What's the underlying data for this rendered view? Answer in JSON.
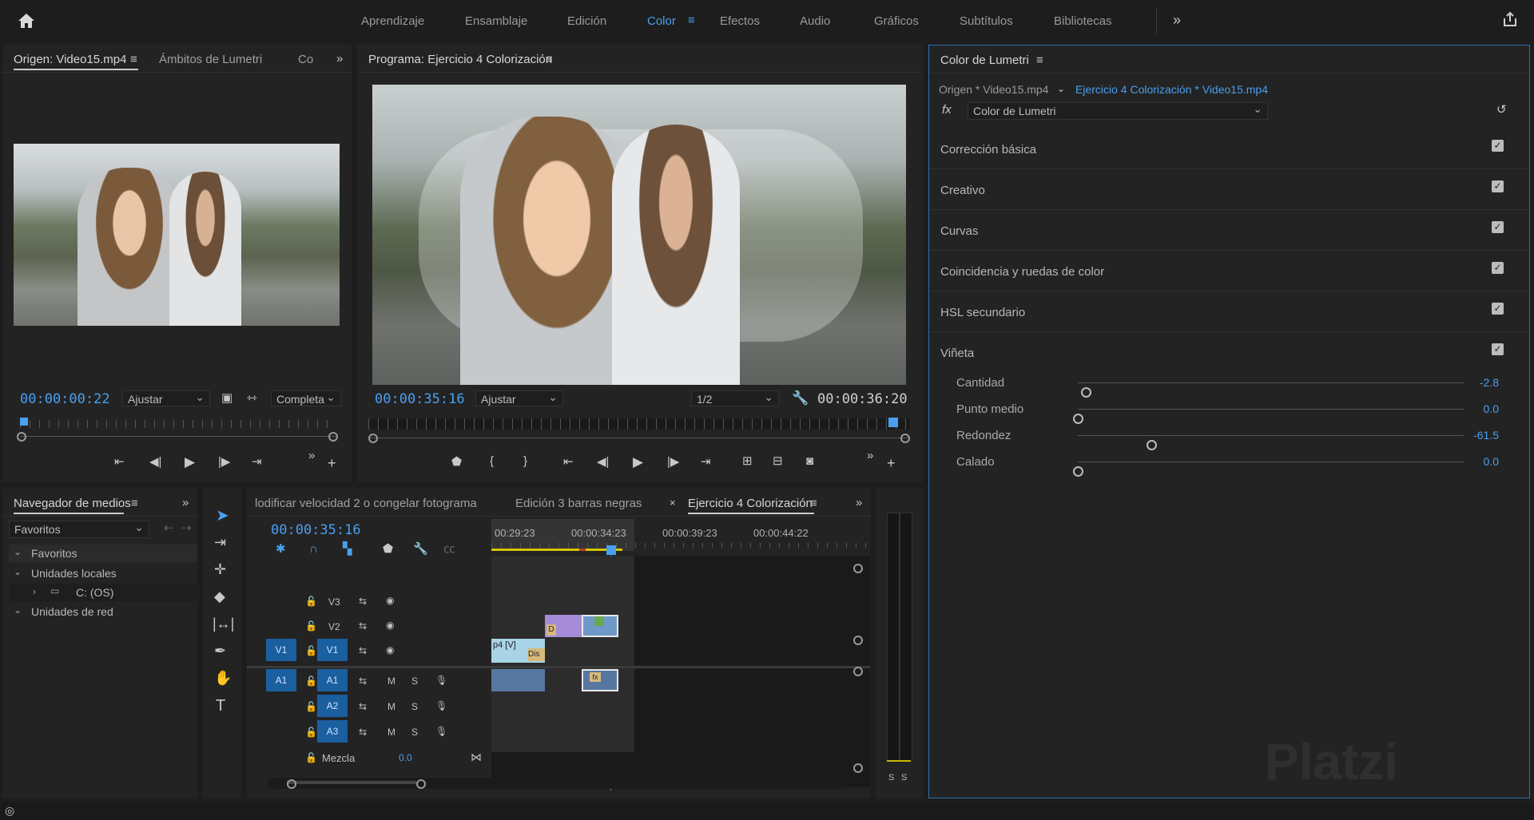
{
  "menubar": {
    "home_icon": "home-icon",
    "items": [
      "Aprendizaje",
      "Ensamblaje",
      "Edición",
      "Color",
      "Efectos",
      "Audio",
      "Gráficos",
      "Subtítulos",
      "Bibliotecas"
    ],
    "active": "Color",
    "overflow": "»"
  },
  "source_monitor": {
    "tabs": [
      "Origen: Video15.mp4",
      "Ámbitos de Lumetri",
      "Co"
    ],
    "timecode": "00:00:00:22",
    "fit": "Ajustar",
    "quality": "Completa"
  },
  "program_monitor": {
    "title": "Programa: Ejercicio 4 Colorización",
    "timecode": "00:00:35:16",
    "fit": "Ajustar",
    "resolution": "1/2",
    "duration": "00:00:36:20"
  },
  "lumetri": {
    "title": "Color de Lumetri",
    "source": "Origen * Video15.mp4",
    "sequence": "Ejercicio 4 Colorización * Video15.mp4",
    "fx_label": "fx",
    "effect": "Color de Lumetri",
    "sections": [
      "Corrección básica",
      "Creativo",
      "Curvas",
      "Coincidencia y ruedas de color",
      "HSL secundario",
      "Viñeta"
    ],
    "vignette": [
      {
        "label": "Cantidad",
        "value": "-2.8",
        "fraction": 0.02
      },
      {
        "label": "Punto medio",
        "value": "0.0",
        "fraction": 0.0
      },
      {
        "label": "Redondez",
        "value": "-61.5",
        "fraction": 0.19
      },
      {
        "label": "Calado",
        "value": "0.0",
        "fraction": 0.0
      }
    ]
  },
  "media_browser": {
    "title": "Navegador de medios",
    "dropdown": "Favoritos",
    "tree": [
      "Favoritos",
      "Unidades locales",
      "C: (OS)",
      "Unidades de red"
    ]
  },
  "timeline": {
    "tabs": [
      "lodificar velocidad 2 o congelar fotograma",
      "Edición 3 barras negras",
      "Ejercicio 4 Colorización"
    ],
    "timecode": "00:00:35:16",
    "ruler": [
      "00:29:23",
      "00:00:34:23",
      "00:00:39:23",
      "00:00:44:22"
    ],
    "tracks": {
      "video": [
        "V3",
        "V2",
        "V1"
      ],
      "audio": [
        "A1",
        "A2",
        "A3"
      ],
      "src_v": "V1",
      "src_a": "A1",
      "mix_label": "Mezcla",
      "mix_value": "0.0"
    },
    "clip_v1": "p4 [V]",
    "clip_dis": "Dis",
    "clip_d": "D",
    "clip_fx": "fx"
  },
  "meter": {
    "s1": "S",
    "s2": "S"
  },
  "watermark": "Platzi"
}
